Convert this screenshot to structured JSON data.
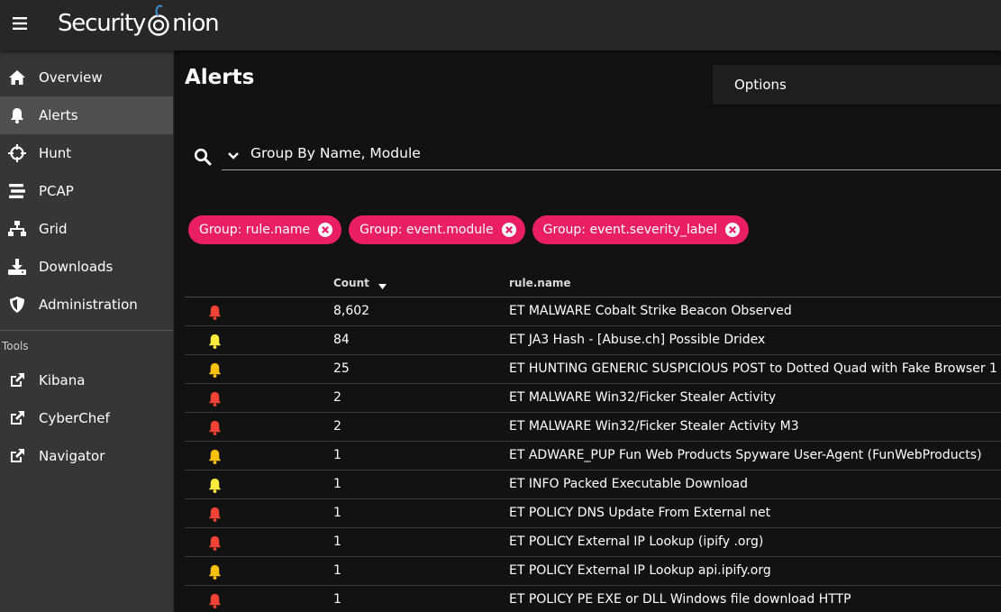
{
  "app": {
    "logo_text_left": "Security",
    "logo_text_right": "nion"
  },
  "icons": {
    "menu": "hamburger-icon",
    "search": "search-icon",
    "chevron": "chevron-down-icon",
    "chip_close": "close-circle-icon",
    "sort": "arrow-down-icon",
    "alert_bell": "bell-icon"
  },
  "colors": {
    "accent": "#e91e63",
    "severity_high": "#f44336",
    "severity_medium": "#ffc107",
    "severity_low": "#ffeb3b"
  },
  "sidebar": {
    "items": [
      {
        "label": "Overview",
        "icon": "home-icon"
      },
      {
        "label": "Alerts",
        "icon": "bell-icon",
        "active": true
      },
      {
        "label": "Hunt",
        "icon": "crosshairs-icon"
      },
      {
        "label": "PCAP",
        "icon": "stream-icon"
      },
      {
        "label": "Grid",
        "icon": "network-icon"
      },
      {
        "label": "Downloads",
        "icon": "download-icon"
      },
      {
        "label": "Administration",
        "icon": "shield-icon"
      }
    ],
    "tools_label": "Tools",
    "tools": [
      {
        "label": "Kibana",
        "icon": "external-link-icon"
      },
      {
        "label": "CyberChef",
        "icon": "external-link-icon"
      },
      {
        "label": "Navigator",
        "icon": "external-link-icon"
      }
    ]
  },
  "main": {
    "title": "Alerts",
    "options_label": "Options",
    "query": "Group By Name, Module",
    "chips": [
      {
        "label": "Group: rule.name"
      },
      {
        "label": "Group: event.module"
      },
      {
        "label": "Group: event.severity_label"
      }
    ],
    "table": {
      "headers": {
        "count": "Count",
        "rule": "rule.name"
      },
      "rows": [
        {
          "severity": "high",
          "count": "8,602",
          "rule": "ET MALWARE Cobalt Strike Beacon Observed"
        },
        {
          "severity": "low",
          "count": "84",
          "rule": "ET JA3 Hash - [Abuse.ch] Possible Dridex"
        },
        {
          "severity": "medium",
          "count": "25",
          "rule": "ET HUNTING GENERIC SUSPICIOUS POST to Dotted Quad with Fake Browser 1"
        },
        {
          "severity": "high",
          "count": "2",
          "rule": "ET MALWARE Win32/Ficker Stealer Activity"
        },
        {
          "severity": "high",
          "count": "2",
          "rule": "ET MALWARE Win32/Ficker Stealer Activity M3"
        },
        {
          "severity": "medium",
          "count": "1",
          "rule": "ET ADWARE_PUP Fun Web Products Spyware User-Agent (FunWebProducts)"
        },
        {
          "severity": "low",
          "count": "1",
          "rule": "ET INFO Packed Executable Download"
        },
        {
          "severity": "high",
          "count": "1",
          "rule": "ET POLICY DNS Update From External net"
        },
        {
          "severity": "high",
          "count": "1",
          "rule": "ET POLICY External IP Lookup (ipify .org)"
        },
        {
          "severity": "medium",
          "count": "1",
          "rule": "ET POLICY External IP Lookup api.ipify.org"
        },
        {
          "severity": "high",
          "count": "1",
          "rule": "ET POLICY PE EXE or DLL Windows file download HTTP"
        }
      ]
    }
  }
}
